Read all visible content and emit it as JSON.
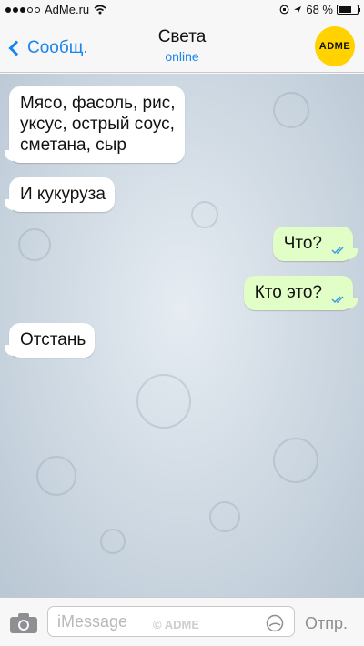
{
  "status_bar": {
    "carrier": "AdMe.ru",
    "time": "",
    "battery_text": "68 %",
    "battery_level": 0.68,
    "signal_dots_filled": 3,
    "signal_dots_total": 5
  },
  "nav": {
    "back_label": "Сообщ.",
    "title": "Света",
    "subtitle": "online",
    "logo_text": "ADME"
  },
  "messages": [
    {
      "direction": "in",
      "lines": [
        "Мясо, фасоль, рис,",
        "уксус, острый соус,",
        "сметана, сыр"
      ]
    },
    {
      "direction": "in",
      "lines": [
        "И кукуруза"
      ]
    },
    {
      "direction": "out",
      "lines": [
        "Что?"
      ],
      "read": true
    },
    {
      "direction": "out",
      "lines": [
        "Кто это?"
      ],
      "read": true
    },
    {
      "direction": "in",
      "lines": [
        "Отстань"
      ]
    }
  ],
  "input": {
    "placeholder": "iMessage",
    "watermark": "© ADME",
    "send_label": "Отпр."
  },
  "colors": {
    "accent": "#1a84f0",
    "outgoing_bubble": "#e1fec6",
    "incoming_bubble": "#ffffff",
    "logo": "#ffd200"
  }
}
